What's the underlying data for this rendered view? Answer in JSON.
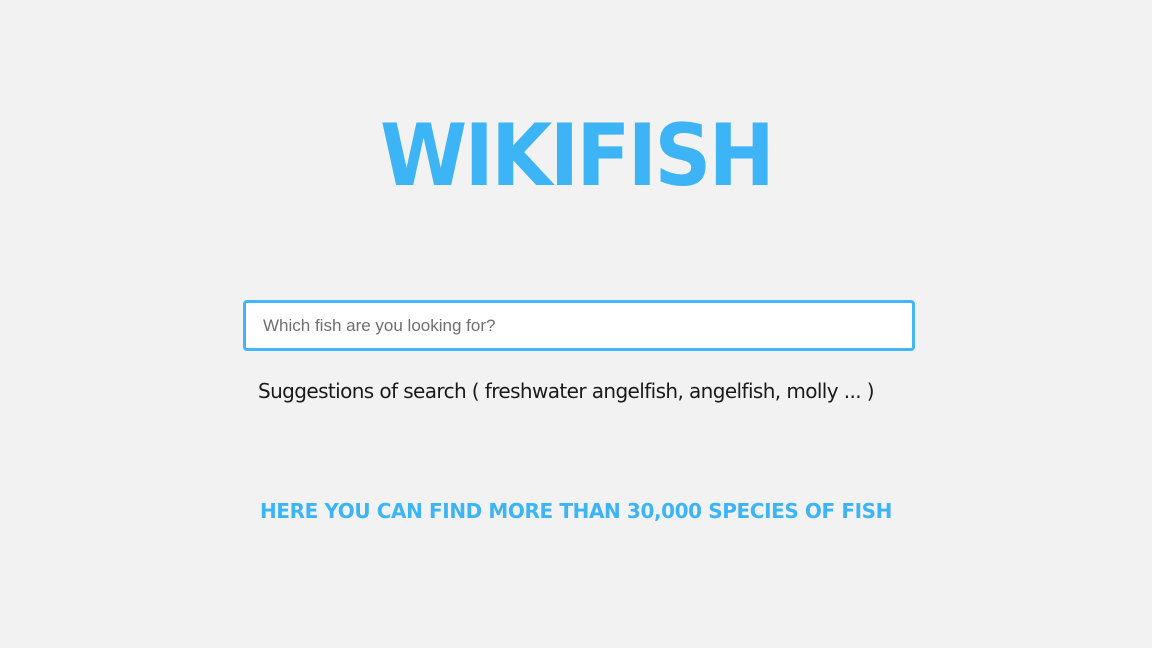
{
  "brand": {
    "logo_text": "WIKIFISH",
    "accent_color": "#3cb4f6"
  },
  "search": {
    "value": "",
    "placeholder": "Which fish are you looking for?"
  },
  "suggestions": {
    "text": "Suggestions of search ( freshwater angelfish, angelfish, molly ... )"
  },
  "tagline": {
    "text": "HERE YOU CAN FIND MORE THAN 30,000 SPECIES OF FISH"
  }
}
